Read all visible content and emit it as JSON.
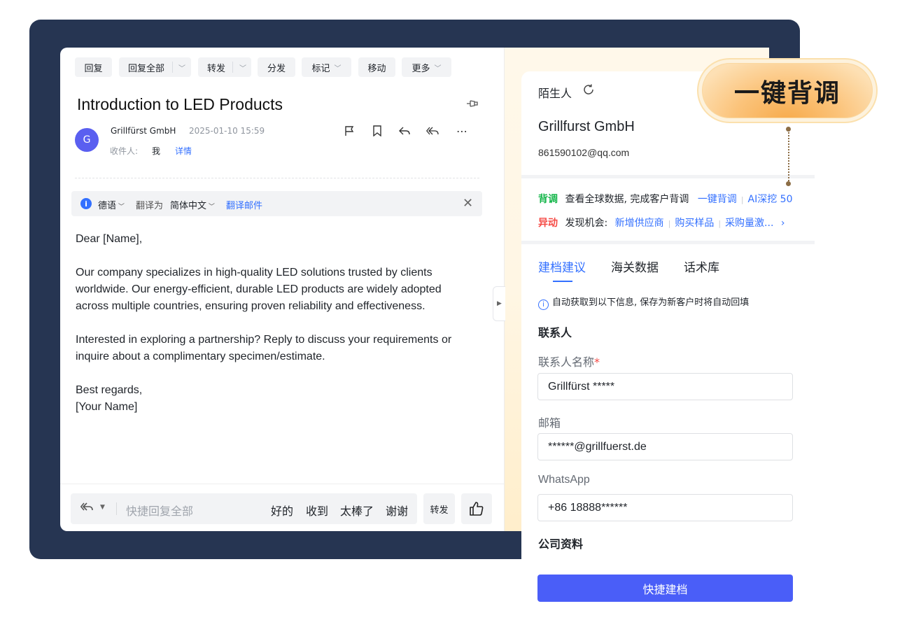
{
  "toolbar": {
    "reply": "回复",
    "reply_all": "回复全部",
    "forward": "转发",
    "distribute": "分发",
    "mark": "标记",
    "move": "移动",
    "more": "更多"
  },
  "email": {
    "subject": "Introduction to LED Products",
    "sender": "Grillfürst GmbH",
    "date": "2025-01-10 15:59",
    "to_label": "收件人:",
    "to_value": "我",
    "details_link": "详情",
    "avatar_letter": "G"
  },
  "translate": {
    "source_lang": "德语",
    "translate_to": "翻译为",
    "target_lang": "简体中文",
    "action": "翻译邮件"
  },
  "body": {
    "greeting": "Dear [Name],",
    "p1_l1": "Our company specializes in high-quality LED solutions trusted by clients",
    "p1_l2": "worldwide. Our energy-efficient, durable LED products are widely adopted",
    "p1_l3": "across multiple countries, ensuring proven reliability and effectiveness.",
    "p2_l1": "Interested in exploring a partnership? Reply to discuss your requirements or",
    "p2_l2": "inquire about a complimentary specimen/estimate.",
    "closing": "Best regards,",
    "signature": "[Your Name]"
  },
  "quick_reply": {
    "placeholder": "快捷回复全部",
    "chips": [
      "好的",
      "收到",
      "太棒了",
      "谢谢"
    ],
    "forward_btn": "转发"
  },
  "side": {
    "status": "陌生人",
    "company": "Grillfurst GmbH",
    "email": "861590102@qq.com",
    "bg_tag": "背调",
    "bg_text": "查看全球数据, 完成客户背调",
    "bg_link": "一键背调",
    "bg_ai": "AI深挖 50",
    "yd_tag": "异动",
    "yd_text": "发现机会:",
    "yd_items": [
      "新增供应商",
      "购买样品",
      "采购量激..."
    ],
    "tabs": [
      "建档建议",
      "海关数据",
      "话术库"
    ],
    "hint": "自动获取到以下信息, 保存为新客户时将自动回填",
    "contact_section": "联系人",
    "name_label": "联系人名称",
    "name_value": "Grillfürst *****",
    "email_label": "邮箱",
    "email_value": "******@grillfuerst.de",
    "whatsapp_label": "WhatsApp",
    "whatsapp_value": "+86 18888******",
    "company_section": "公司资料",
    "save_btn": "快捷建档"
  },
  "callout": {
    "text": "一键背调"
  },
  "colors": {
    "frame": "#263552",
    "accent_blue": "#3370ff",
    "button_blue": "#4a5ef8",
    "avatar": "#5a5ff0",
    "tag_green": "#14b64a",
    "tag_red": "#f54a45",
    "callout_orange": "#f7aa4a"
  },
  "icons": [
    "info-icon",
    "close-icon",
    "pin-icon",
    "flag-icon",
    "bookmark-icon",
    "reply-icon",
    "reply-all-icon",
    "more-icon",
    "collapse-arrow-icon",
    "thumbs-up-icon",
    "refresh-icon",
    "chevron-right-icon"
  ]
}
